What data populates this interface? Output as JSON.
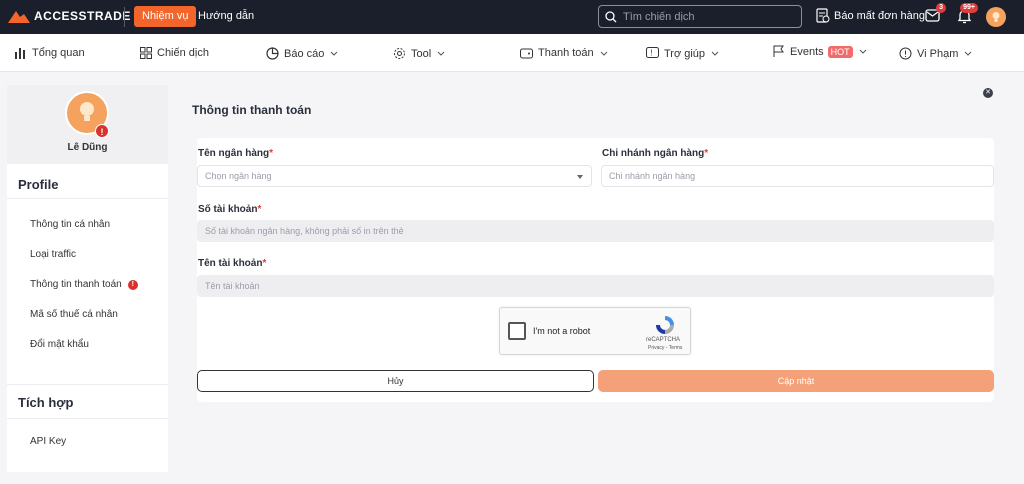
{
  "topbar": {
    "brand": "ACCESSTRADE",
    "nav_active": "Nhiệm vụ",
    "nav_guide": "Hướng dẫn",
    "search_placeholder": "Tìm chiến dịch",
    "report_label": "Báo mất đơn hàng",
    "mail_badge": "3",
    "notif_badge": "99+",
    "accent": "#f2662c"
  },
  "subnav": {
    "items": [
      {
        "label": "Tổng quan",
        "icon": "bar-chart-icon"
      },
      {
        "label": "Chiến dịch",
        "icon": "grid-icon"
      },
      {
        "label": "Báo cáo",
        "icon": "pie-chart-icon"
      },
      {
        "label": "Tool",
        "icon": "gear-icon"
      },
      {
        "label": "Thanh toán",
        "icon": "wallet-icon"
      },
      {
        "label": "Trợ giúp",
        "icon": "help-icon"
      },
      {
        "label": "Events",
        "icon": "flag-icon",
        "badge": "HOT"
      },
      {
        "label": "Vi Phạm",
        "icon": "warning-icon"
      }
    ]
  },
  "sidebar": {
    "user_name": "Lê Dũng",
    "profile_title": "Profile",
    "profile_items": [
      {
        "label": "Thông tin cá nhân"
      },
      {
        "label": "Loại traffic"
      },
      {
        "label": "Thông tin thanh toán",
        "alert": "!"
      },
      {
        "label": "Mã số thuế cá nhân"
      },
      {
        "label": "Đổi mật khẩu"
      }
    ],
    "integration_title": "Tích hợp",
    "integration_items": [
      {
        "label": "API Key"
      }
    ]
  },
  "main": {
    "title": "Thông tin thanh toán",
    "bank_label": "Tên ngân hàng",
    "bank_placeholder": "Chọn ngân hàng",
    "branch_label": "Chi nhánh ngân hàng",
    "branch_placeholder": "Chi nhánh ngân hàng",
    "account_no_label": "Số tài khoản",
    "account_no_placeholder": "Số tài khoản ngân hàng, không phải số in trên thẻ",
    "account_name_label": "Tên tài khoản",
    "account_name_placeholder": "Tên tài khoản",
    "required_mark": "*",
    "recaptcha_label": "I'm not a robot",
    "recaptcha_brand": "reCAPTCHA",
    "recaptcha_links": "Privacy - Terms",
    "cancel_label": "Hủy",
    "update_label": "Cập nhật"
  }
}
